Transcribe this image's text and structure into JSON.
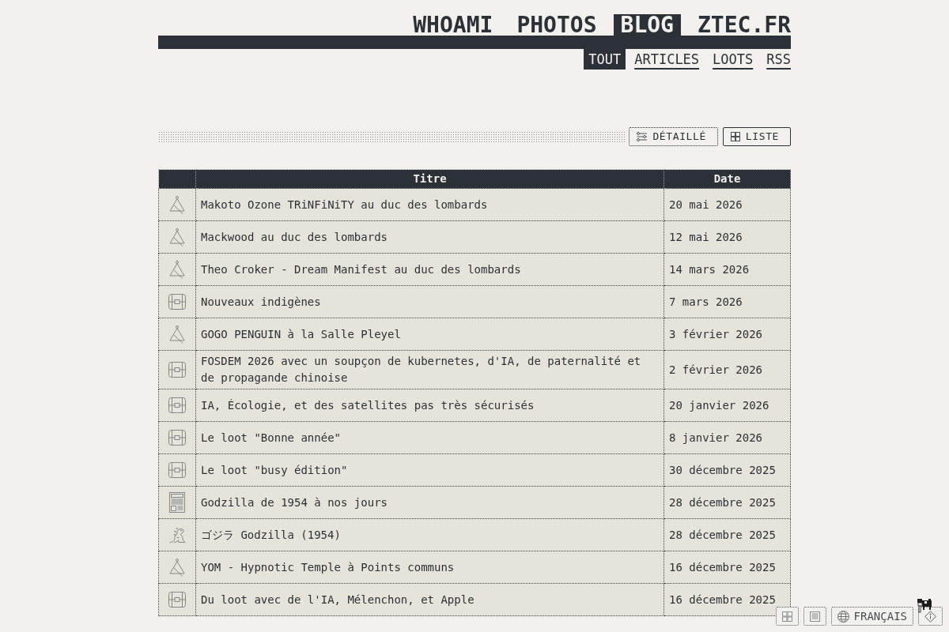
{
  "nav": {
    "items": [
      {
        "label": "WHOAMI",
        "selected": false
      },
      {
        "label": "PHOTOS",
        "selected": false
      },
      {
        "label": "BLOG",
        "selected": true
      },
      {
        "label": "ZTEC.FR",
        "selected": false
      }
    ]
  },
  "subnav": {
    "items": [
      {
        "label": "TOUT",
        "selected": true
      },
      {
        "label": "ARTICLES",
        "selected": false
      },
      {
        "label": "LOOTS",
        "selected": false
      },
      {
        "label": "RSS",
        "selected": false
      }
    ]
  },
  "view_toggle": [
    {
      "kind": "detailed",
      "label": "DÉTAILLÉ",
      "selected": false
    },
    {
      "kind": "list",
      "label": "LISTE",
      "selected": true
    }
  ],
  "table": {
    "columns": [
      "Titre",
      "Date"
    ],
    "rows": [
      {
        "kind": "concert",
        "title": "Makoto Ozone TRiNFiNiTY au duc des lombards",
        "date": "20 mai 2026"
      },
      {
        "kind": "concert",
        "title": "Mackwood au duc des lombards",
        "date": "12 mai 2026"
      },
      {
        "kind": "concert",
        "title": "Theo Croker - Dream Manifest au duc des lombards",
        "date": "14 mars 2026"
      },
      {
        "kind": "loot",
        "title": "Nouveaux indigènes",
        "date": "7 mars 2026"
      },
      {
        "kind": "concert",
        "title": "GOGO PENGUIN à la Salle Pleyel",
        "date": "3 février 2026"
      },
      {
        "kind": "loot",
        "title": "FOSDEM 2026 avec un soupçon de kubernetes, d'IA, de paternalité et de propagande chinoise",
        "date": "2 février 2026"
      },
      {
        "kind": "loot",
        "title": "IA, Écologie, et des satellites pas très sécurisés",
        "date": "20 janvier 2026"
      },
      {
        "kind": "loot",
        "title": "Le loot \"Bonne année\"",
        "date": "8 janvier 2026"
      },
      {
        "kind": "loot",
        "title": "Le loot \"busy édition\"",
        "date": "30 décembre 2025"
      },
      {
        "kind": "article",
        "title": "Godzilla de 1954 à nos jours",
        "date": "28 décembre 2025"
      },
      {
        "kind": "movie",
        "title": "ゴジラ Godzilla (1954)",
        "date": "28 décembre 2025"
      },
      {
        "kind": "concert",
        "title": "YOM - Hypnotic Temple à Points communs",
        "date": "16 décembre 2025"
      },
      {
        "kind": "loot",
        "title": "Du loot avec de l'IA, Mélenchon, et Apple",
        "date": "16 décembre 2025"
      }
    ]
  },
  "floating_toolbar": [
    {
      "kind": "grid"
    },
    {
      "kind": "list"
    },
    {
      "kind": "language",
      "label": "FRANÇAIS"
    },
    {
      "kind": "info"
    }
  ]
}
